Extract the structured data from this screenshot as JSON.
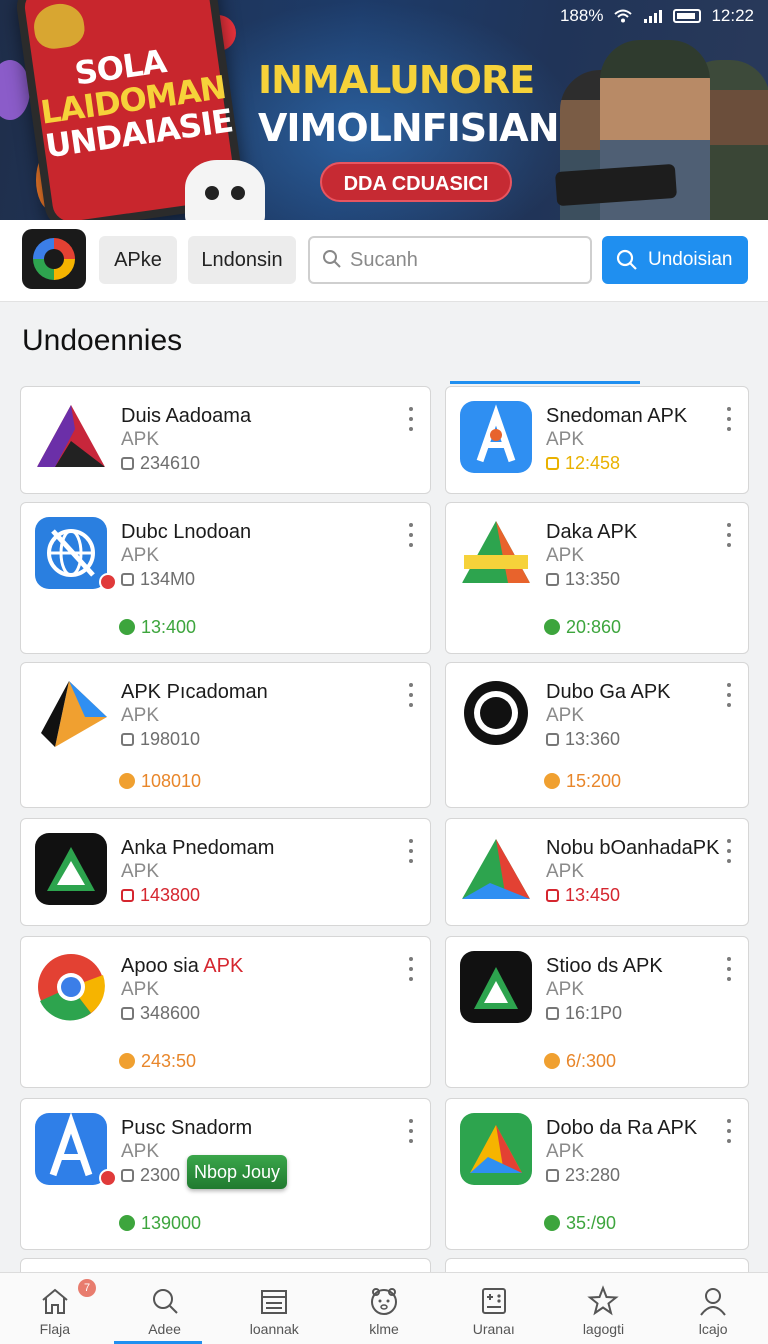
{
  "status_bar": {
    "battery": "188%",
    "time": "12:22"
  },
  "banner": {
    "phone_lines": [
      "SOLA",
      "LAIDOMAN",
      "UNDAIASIE"
    ],
    "headline_1": "INMALUNORE",
    "headline_2": "VIMOLNFISIAN",
    "cta": "DDA CDUASICI"
  },
  "toolbar": {
    "chip_1": "APke",
    "chip_2": "Lndonsin",
    "search_placeholder": "Sucanh",
    "primary_button": "Undoisian"
  },
  "section": {
    "title": "Undoennies"
  },
  "apps": [
    {
      "name": "Duis Aadoama",
      "type": "APK",
      "size": "234610"
    },
    {
      "name": "Snedoman APK",
      "type": "APK",
      "size": "12:458"
    },
    {
      "name": "Dubc Lnodoan",
      "type": "APK",
      "size": "134M0",
      "stat": "13:400"
    },
    {
      "name": "Daka APK",
      "type": "APK",
      "size": "13:350",
      "stat": "20:860"
    },
    {
      "name": "APK Pıcadoman",
      "type": "APK",
      "size": "198010",
      "stat": "108010"
    },
    {
      "name": "Dubo Ga APK",
      "type": "APK",
      "size": "13:360",
      "stat": "15:200"
    },
    {
      "name": "Anka Pnedomam",
      "type": "APK",
      "size": "143800"
    },
    {
      "name": "Nobu bOanhadaPK",
      "type": "APK",
      "size": "13:450"
    },
    {
      "name_pre": "Apoo sia ",
      "name_red": "APK",
      "type": "APK",
      "size": "348600",
      "stat": "243:50"
    },
    {
      "name": "Stioo ds APK",
      "type": "APK",
      "size": "16:1P0",
      "stat": "6/:300"
    },
    {
      "name": "Pusc Snadorm",
      "type": "APK",
      "size": "2300",
      "stat": "139000",
      "tag": "Nbop Jouy"
    },
    {
      "name": "Dobo da Ra APK",
      "type": "APK",
      "size": "23:280",
      "stat": "35:/90"
    }
  ],
  "bottom_nav": [
    {
      "label": "Flaja",
      "icon": "home-icon",
      "badge": "7"
    },
    {
      "label": "Adee",
      "icon": "search-icon"
    },
    {
      "label": "loannak",
      "icon": "calendar-icon"
    },
    {
      "label": "klme",
      "icon": "mascot-icon"
    },
    {
      "label": "Uranaı",
      "icon": "gamepad-icon"
    },
    {
      "label": "lagogti",
      "icon": "star-icon"
    },
    {
      "label": "lcajo",
      "icon": "profile-icon"
    }
  ],
  "colors": {
    "accent": "#1f8ff0",
    "cta_red": "#c62a33",
    "headline_yellow": "#f6d23a"
  }
}
